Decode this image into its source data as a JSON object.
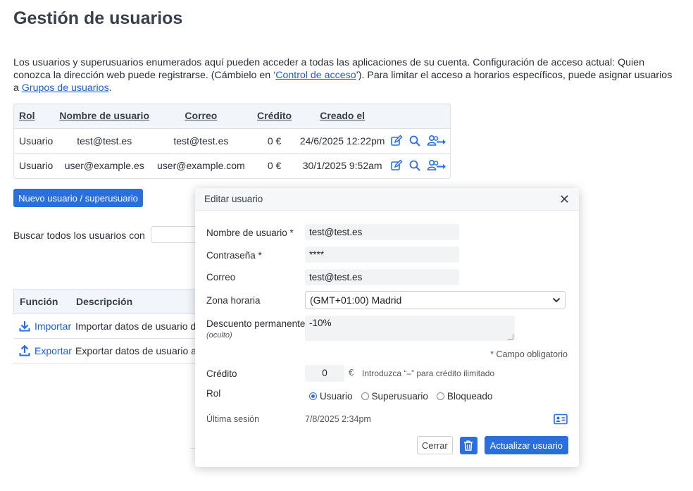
{
  "page": {
    "title": "Gestión de usuarios",
    "intro_1": "Los usuarios y superusuarios enumerados aquí pueden acceder a todas las aplicaciones de su cuenta. Configuración de acceso actual: Quien conozca la dirección web puede registrarse. (Cámbielo en ‘",
    "intro_link1": "Control de acceso",
    "intro_2": "’). Para limitar el acceso a horarios específicos, puede asignar usuarios a ",
    "intro_link2": "Grupos de usuarios",
    "intro_3": "."
  },
  "users_table": {
    "headers": [
      "Rol",
      "Nombre de usuario",
      "Correo",
      "Crédito",
      "Creado el"
    ],
    "rows": [
      {
        "role": "Usuario",
        "username": "test@test.es",
        "email": "test@test.es",
        "credit": "0 €",
        "created": "24/6/2025 12:22pm"
      },
      {
        "role": "Usuario",
        "username": "user@example.es",
        "email": "user@example.com",
        "credit": "0 €",
        "created": "30/1/2025 9:52am"
      }
    ],
    "row_actions": [
      "edit-icon",
      "search-icon",
      "user-transfer-icon"
    ]
  },
  "new_user_button": "Nuevo usuario / superusuario",
  "search": {
    "label": "Buscar todos los usuarios con",
    "value": ""
  },
  "functions_table": {
    "headers": [
      "Función",
      "Descripción"
    ],
    "rows": [
      {
        "icon": "download-icon",
        "name": "Importar",
        "description": "Importar datos de usuario d"
      },
      {
        "icon": "upload-icon",
        "name": "Exportar",
        "description": "Exportar datos de usuario a"
      }
    ]
  },
  "modal": {
    "title": "Editar usuario",
    "close": "✕",
    "username_label": "Nombre de usuario *",
    "username_value": "test@test.es",
    "password_label": "Contraseña *",
    "password_value": "****",
    "email_label": "Correo",
    "email_value": "test@test.es",
    "timezone_label": "Zona horaria",
    "timezone_value": "(GMT+01:00) Madrid",
    "discount_label": "Descuento permanente",
    "discount_sublabel": "(oculto)",
    "discount_value": "-10%",
    "required_note": "* Campo obligatorio",
    "credit_label": "Crédito",
    "credit_value": "0",
    "credit_currency": "€",
    "credit_hint": "Introduzca “–” para crédito ilimitado",
    "role_label": "Rol",
    "roles": [
      "Usuario",
      "Superusuario",
      "Bloqueado"
    ],
    "selected_role": "Usuario",
    "last_session_label": "Última sesión",
    "last_session_value": "7/8/2025 2:34pm",
    "close_button": "Cerrar",
    "update_button": "Actualizar usuario"
  },
  "colors": {
    "accent": "#2a6fe0",
    "link": "#1a5fd6",
    "header_bg": "#f2f5f9"
  }
}
